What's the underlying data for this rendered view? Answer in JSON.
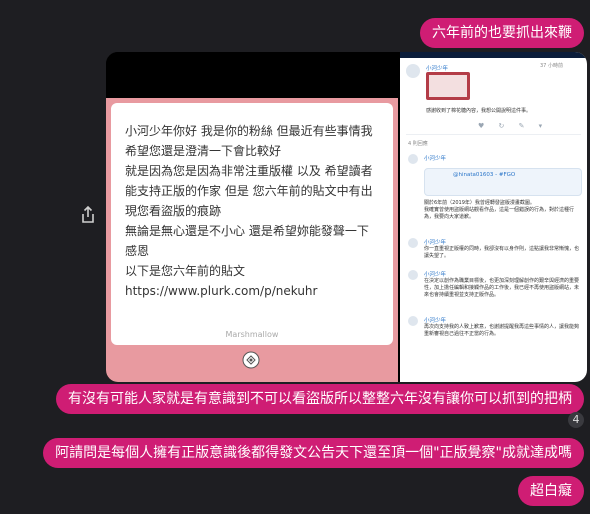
{
  "messages": [
    {
      "id": "b1",
      "text": "六年前的也要抓出來鞭"
    },
    {
      "id": "b2",
      "text": "有沒有可能人家就是有意識到不可以看盜版所以整整六年沒有讓你可以抓到的把柄"
    },
    {
      "id": "b3",
      "text": "阿請問是每個人擁有正版意識後都得發文公告天下還至頂一個\"正版覺察\"成就達成嗎"
    },
    {
      "id": "b4",
      "text": "超白癡"
    }
  ],
  "reaction_count": "4",
  "image": {
    "marshmallow": {
      "body": "小河少年你好 我是你的粉絲 但最近有些事情我希望您還是澄清一下會比較好\n就是因為您是因為非常注重版權 以及 希望讀者能支持正版的作家 但是 您六年前的貼文中有出現您看盜版的痕跡\n無論是無心還是不小心 還是希望妳能發聲一下感恩\n以下是您六年前的貼文\nhttps://www.plurk.com/p/nekuhr",
      "footer": "Marshmallow"
    },
    "plurk": {
      "top_name": "小河少年",
      "top_meta": "37 小時前",
      "top_text": "感謝收到了棉花糖內容，我想公開說明這件事。",
      "response_count": "4 則回應",
      "replies": [
        {
          "name": "小河少年",
          "link": "@hinata01603 - #FGO",
          "text": "關於6年前（2019年）我曾經轉發盜版漫畫截圖。\n我確實曾使用盜版網站觀看作品，這是一個錯誤的行為，對於這種行為，我要向大家道歉。"
        },
        {
          "name": "小河少年",
          "text": "你一直重視正版權的同時，我卻沒有以身作則，這點讓我非常慚愧，也讓失望了。"
        },
        {
          "name": "小河少年",
          "text": "在決定以創作為職業目標後，也更加深刻理解創作的艱辛與經濟的重要性，加上擔任編輯和接觸作品的工作後，我已經不再使用盜版網站，未來也會持續重視並支持正版作品。"
        },
        {
          "name": "小河少年",
          "text": "再次向支持我的人致上歉意，也謝謝提醒我再這些事情的人，讓我能夠重新審視自己過往不正當的行為。"
        }
      ]
    }
  }
}
